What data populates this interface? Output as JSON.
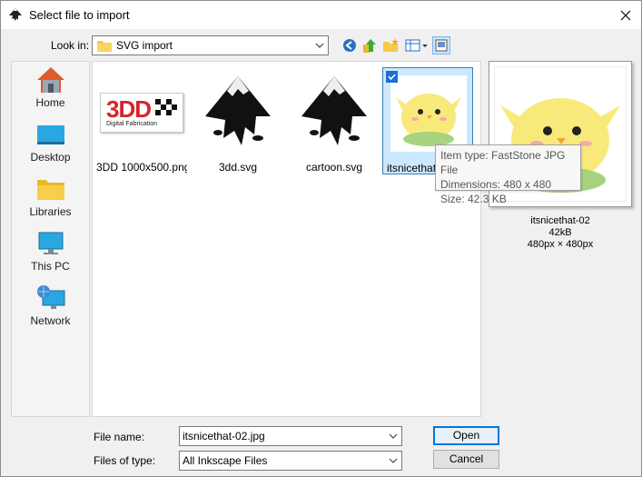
{
  "window": {
    "title": "Select file to import"
  },
  "lookin": {
    "label": "Look in:",
    "value": "SVG import"
  },
  "places": [
    {
      "label": "Home",
      "icon": "home-icon"
    },
    {
      "label": "Desktop",
      "icon": "desktop-icon"
    },
    {
      "label": "Libraries",
      "icon": "libraries-icon"
    },
    {
      "label": "This PC",
      "icon": "this-pc-icon"
    },
    {
      "label": "Network",
      "icon": "network-icon"
    }
  ],
  "files": [
    {
      "name": "3DD 1000x500.png",
      "logo_text": "3DD",
      "logo_sub": "Digital Fabrication"
    },
    {
      "name": "3dd.svg"
    },
    {
      "name": "cartoon.svg"
    },
    {
      "name": "itsnicethat-02.jpg",
      "display": "itsnicethat",
      "selected": true
    }
  ],
  "tooltip": {
    "line1": "Item type: FastStone JPG File",
    "line2": "Dimensions: 480 x 480",
    "line3": "Size: 42.3 KB"
  },
  "preview": {
    "name": "itsnicethat-02",
    "size": "42kB",
    "dimensions": "480px × 480px"
  },
  "filename": {
    "label": "File name:",
    "value": "itsnicethat-02.jpg"
  },
  "filetype": {
    "label": "Files of type:",
    "value": "All Inkscape Files"
  },
  "buttons": {
    "open": "Open",
    "cancel": "Cancel"
  },
  "colors": {
    "accent": "#0078d7",
    "selection": "#cce8ff",
    "folder": "#f7c948"
  }
}
